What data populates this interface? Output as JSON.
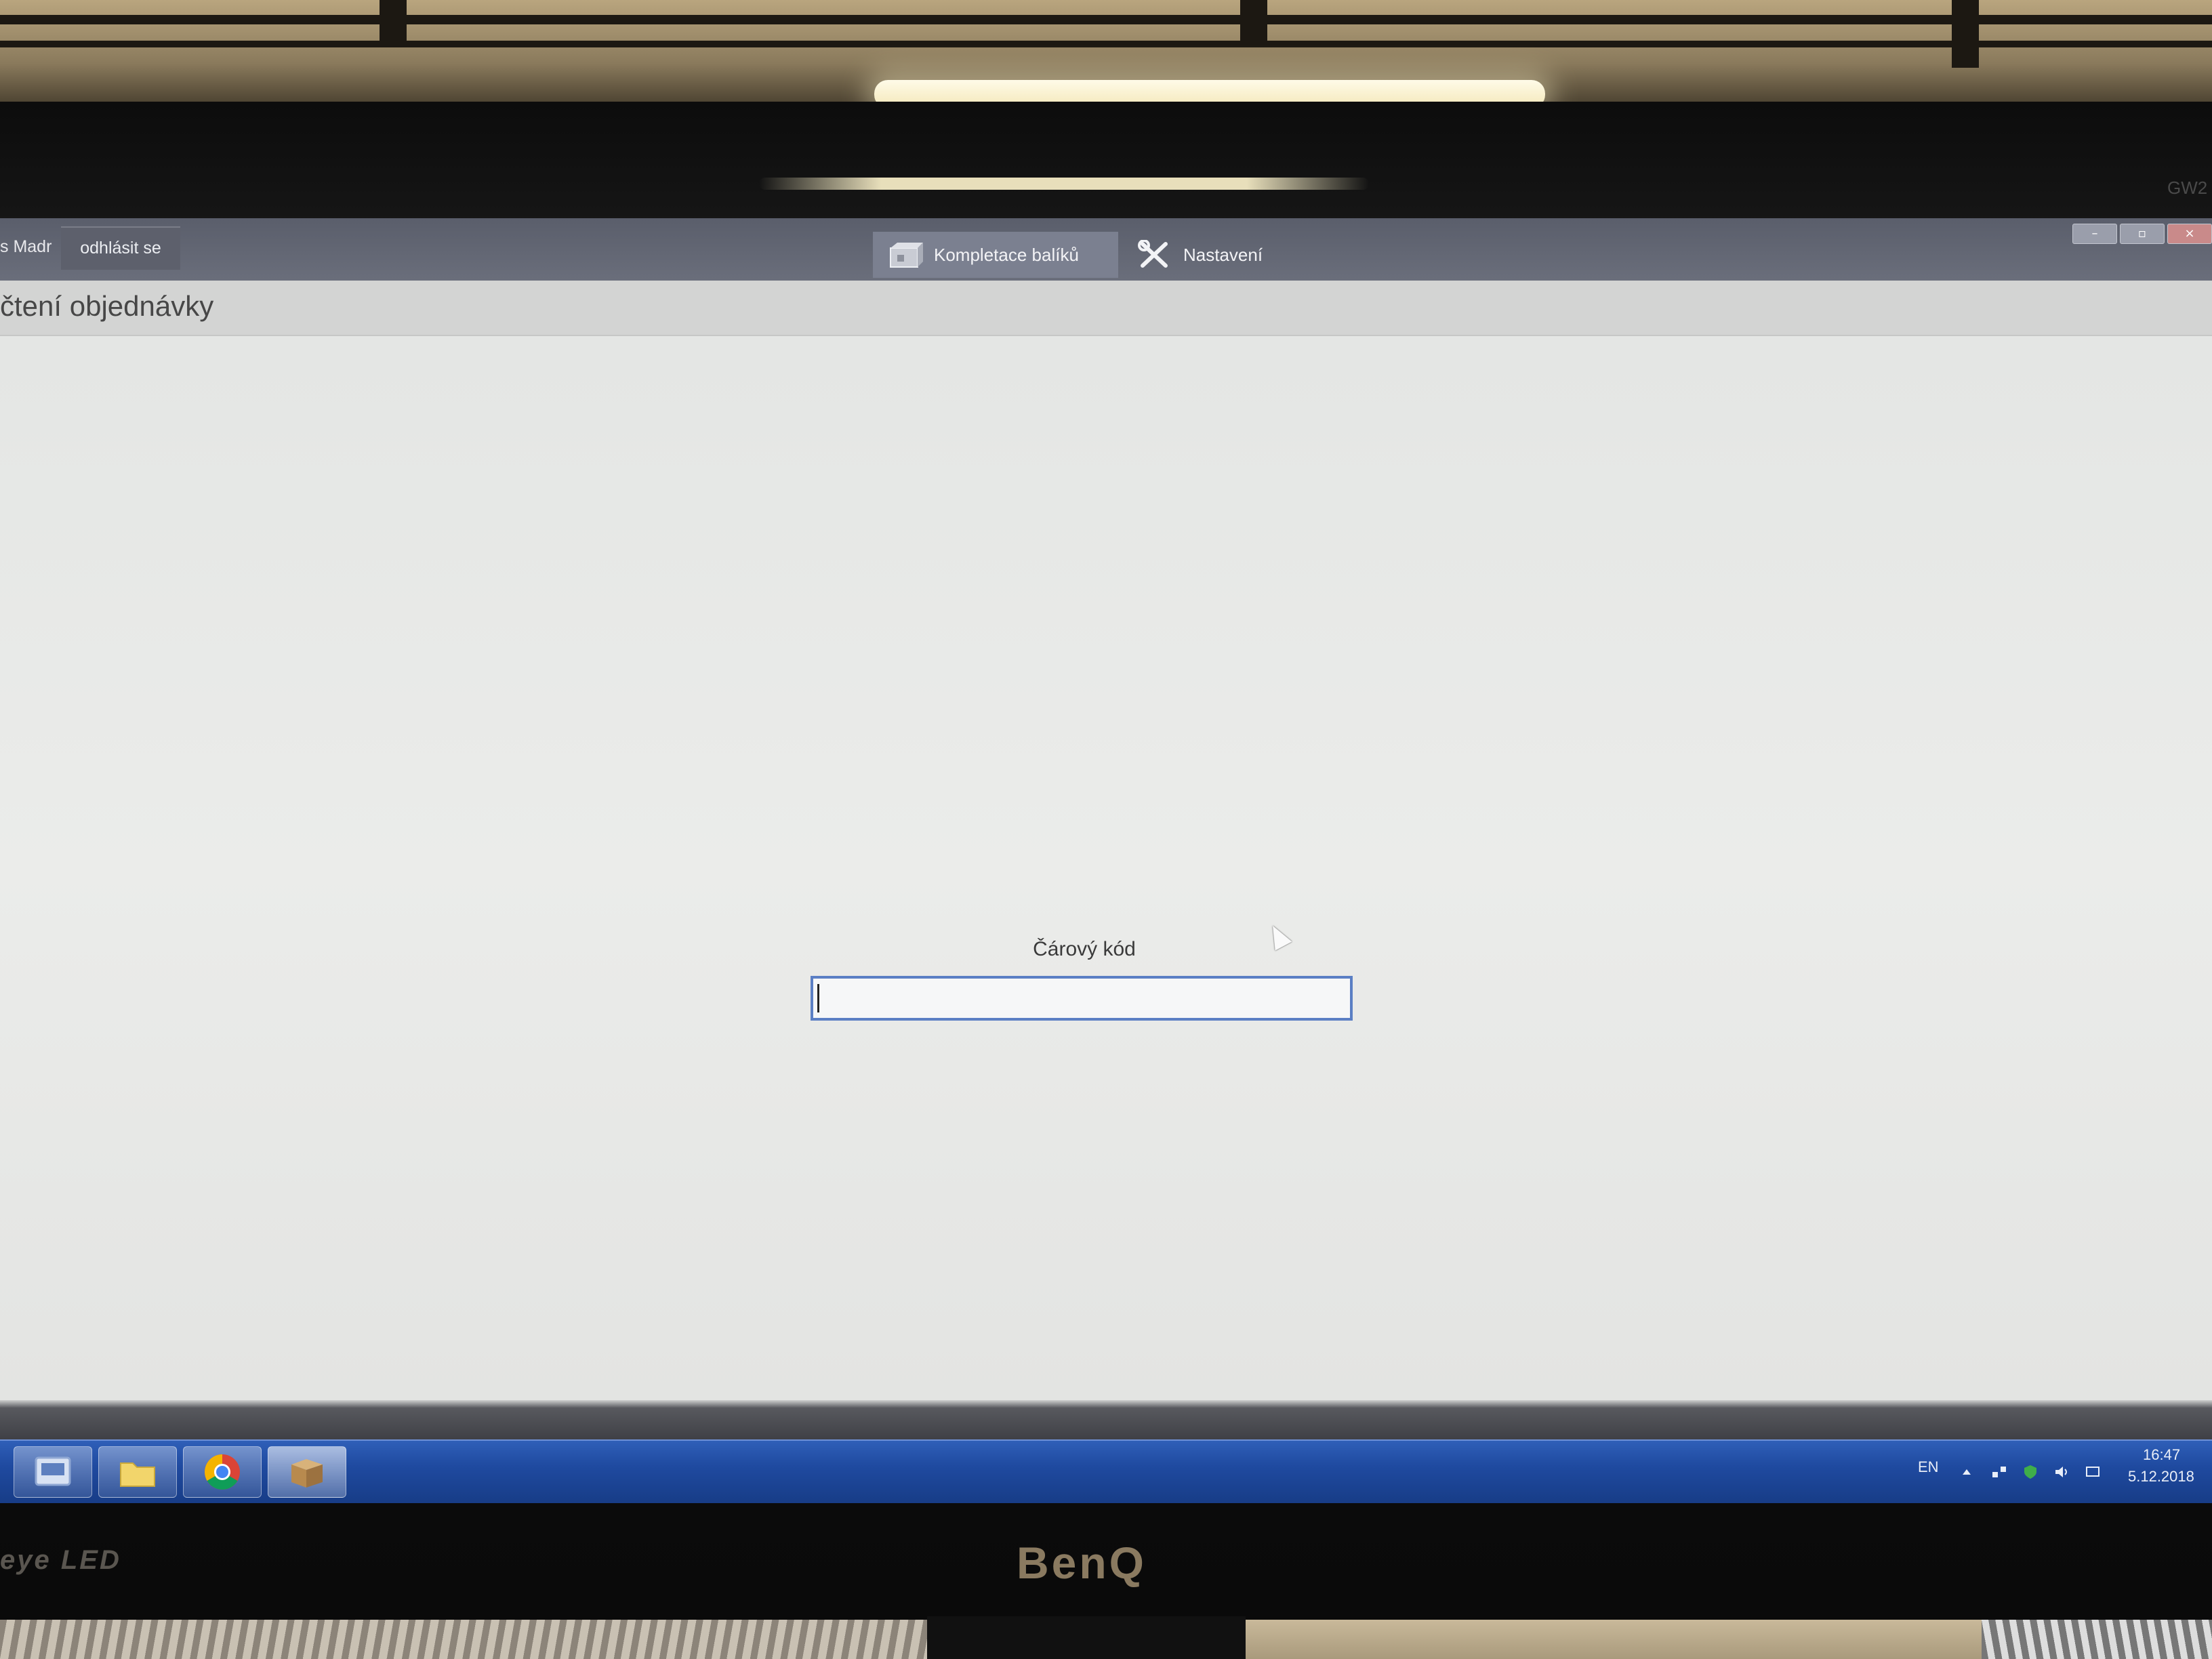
{
  "app": {
    "user_name": "s Madr",
    "logout_label": "odhlásit se",
    "nav": [
      {
        "label": "Kompletace balíků",
        "icon": "package-icon",
        "active": true
      },
      {
        "label": "Nastavení",
        "icon": "tools-icon",
        "active": false
      }
    ],
    "window_controls": [
      "minimize-icon",
      "maximize-icon",
      "close-icon"
    ],
    "page_title": "čtení objednávky"
  },
  "form": {
    "barcode_label": "Čárový kód",
    "barcode_value": "",
    "barcode_placeholder": ""
  },
  "taskbar": {
    "pinned": [
      {
        "name": "start-orb-icon"
      },
      {
        "name": "file-explorer-icon"
      },
      {
        "name": "chrome-icon"
      },
      {
        "name": "package-app-icon",
        "active": true
      }
    ],
    "tray": {
      "language": "EN",
      "time": "16:47",
      "date": "5.12.2018",
      "icons": [
        "tray-arrow-icon",
        "network-icon",
        "shield-icon",
        "volume-icon",
        "action-center-icon"
      ]
    }
  },
  "hardware": {
    "monitor_brand": "BenQ",
    "monitor_series": "eye LED",
    "model_code": "GW2"
  },
  "colors": {
    "topbar": "#5a5e6b",
    "active_tab": "#7b8090",
    "input_border": "#5b7fc4",
    "taskbar": "#1f4aa0"
  }
}
